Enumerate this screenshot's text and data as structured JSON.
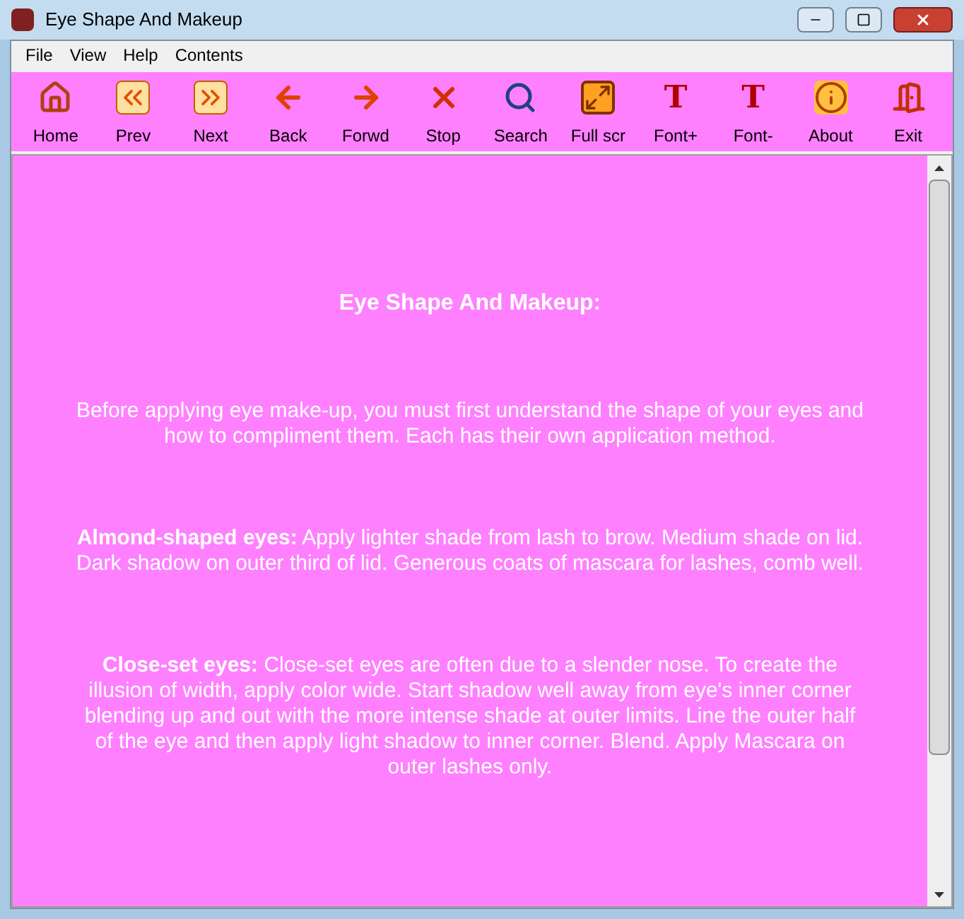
{
  "window": {
    "title": "Eye Shape And Makeup"
  },
  "menu": [
    "File",
    "View",
    "Help",
    "Contents"
  ],
  "toolbar": [
    {
      "label": "Home",
      "kind": "home"
    },
    {
      "label": "Prev",
      "kind": "prev"
    },
    {
      "label": "Next",
      "kind": "next"
    },
    {
      "label": "Back",
      "kind": "back"
    },
    {
      "label": "Forwd",
      "kind": "forward"
    },
    {
      "label": "Stop",
      "kind": "stop"
    },
    {
      "label": "Search",
      "kind": "search"
    },
    {
      "label": "Full scr",
      "kind": "fullscreen"
    },
    {
      "label": "Font+",
      "kind": "fontup",
      "glyph": "T"
    },
    {
      "label": "Font-",
      "kind": "fontdown",
      "glyph": "T"
    },
    {
      "label": "About",
      "kind": "about"
    },
    {
      "label": "Exit",
      "kind": "exit"
    }
  ],
  "content": {
    "heading": "Eye Shape And Makeup:",
    "paragraphs": [
      "Before applying eye make-up, you must first understand the shape of your eyes and how to compliment them. Each has their own application method.",
      "**Almond-shaped eyes:** Apply lighter shade from lash to brow. Medium shade on lid. Dark shadow on outer third of lid. Generous coats of mascara for lashes, comb well.",
      "**Close-set eyes:** Close-set eyes are often due to a slender nose. To create the illusion of width, apply color wide. Start shadow well away from eye's inner corner blending up and out with the more intense shade at outer limits. Line the outer half of the eye and then apply light shadow to inner corner. Blend. Apply Mascara on outer lashes only."
    ]
  }
}
